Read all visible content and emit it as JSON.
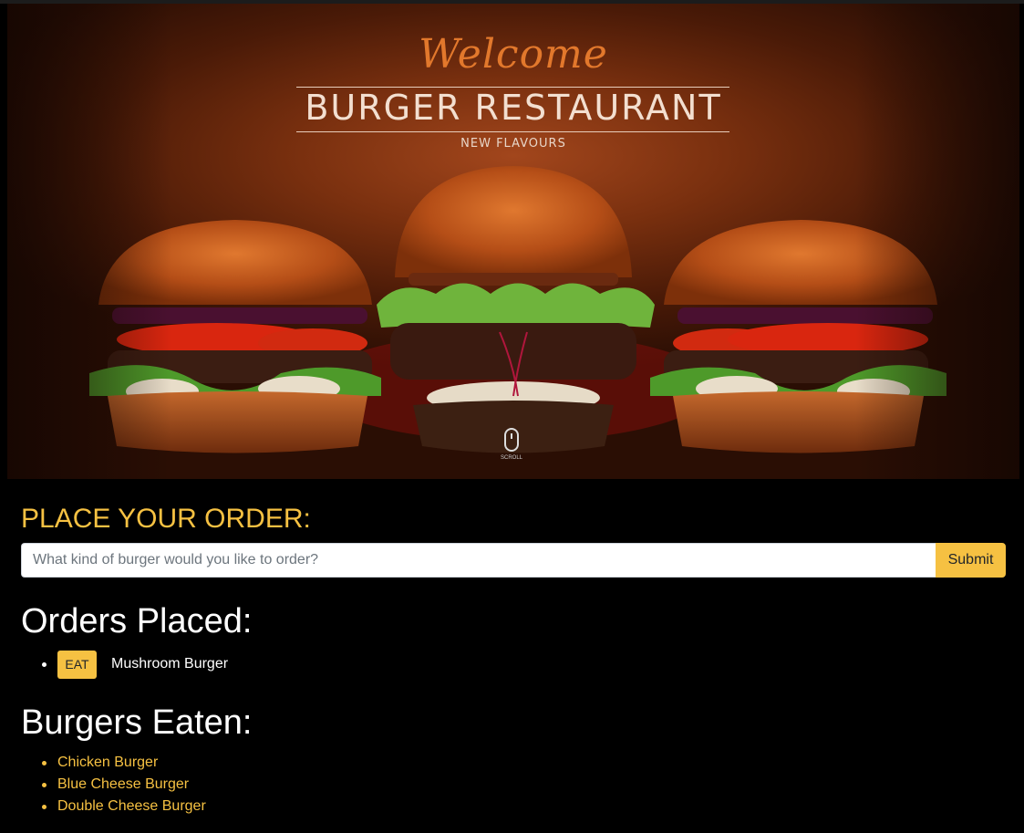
{
  "hero": {
    "welcome": "Welcome",
    "title": "BURGER RESTAURANT",
    "subtitle": "NEW FLAVOURS",
    "scroll_label": "SCROLL",
    "image": "three-burgers-photo"
  },
  "order_form": {
    "heading": "PLACE YOUR ORDER:",
    "placeholder": "What kind of burger would you like to order?",
    "value": "",
    "submit_label": "Submit"
  },
  "orders_placed": {
    "title": "Orders Placed:",
    "items": [
      {
        "button_label": "EAT",
        "name": "Mushroom Burger"
      }
    ]
  },
  "burgers_eaten": {
    "title": "Burgers Eaten:",
    "items": [
      "Chicken Burger",
      "Blue Cheese Burger",
      "Double Cheese Burger"
    ]
  },
  "colors": {
    "accent": "#f6c142",
    "background": "#000000",
    "welcome_script": "#e2782c"
  }
}
